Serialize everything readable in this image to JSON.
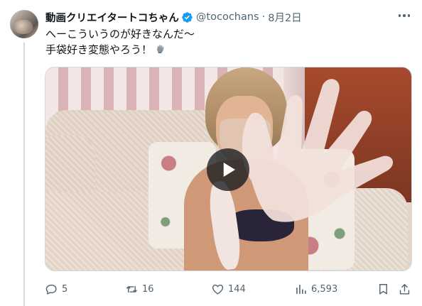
{
  "tweet": {
    "display_name": "動画クリエイタートコちゃん",
    "handle": "@tocochans",
    "separator": "·",
    "date": "8月2日",
    "text_line_1": "へーこういうのが好きなんだ〜",
    "text_line_2": "手袋好き変態やろう！",
    "text_emoji": "glove-emoji",
    "verified_badge": "verified-badge-icon"
  },
  "media": {
    "type": "video",
    "play_icon": "play-icon"
  },
  "actions": {
    "reply_count": "5",
    "retweet_count": "16",
    "like_count": "144",
    "view_count": "6,593"
  },
  "colors": {
    "verified_blue": "#1d9bf0",
    "secondary_text": "#536471",
    "primary_text": "#0f1419"
  }
}
